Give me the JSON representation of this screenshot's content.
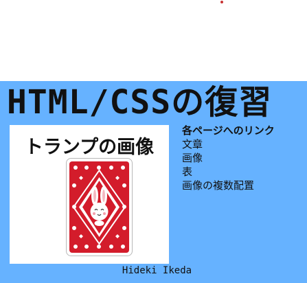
{
  "header": {
    "title": "HTML/CSSの復習"
  },
  "card": {
    "title": "トランプの画像",
    "image_icon": "playing-card-rabbit-back",
    "colors": {
      "card_red": "#d31c2b",
      "frame": "#b8b8b8"
    }
  },
  "nav": {
    "heading": "各ページへのリンク",
    "links": [
      {
        "label": "文章"
      },
      {
        "label": "画像"
      },
      {
        "label": "表"
      },
      {
        "label": "画像の複数配置"
      }
    ]
  },
  "footer": {
    "author": "Hideki Ikeda"
  },
  "colors": {
    "background": "#66b2ff",
    "top_area": "#ffffff",
    "text": "#111111",
    "accent_dot": "#c83232"
  }
}
